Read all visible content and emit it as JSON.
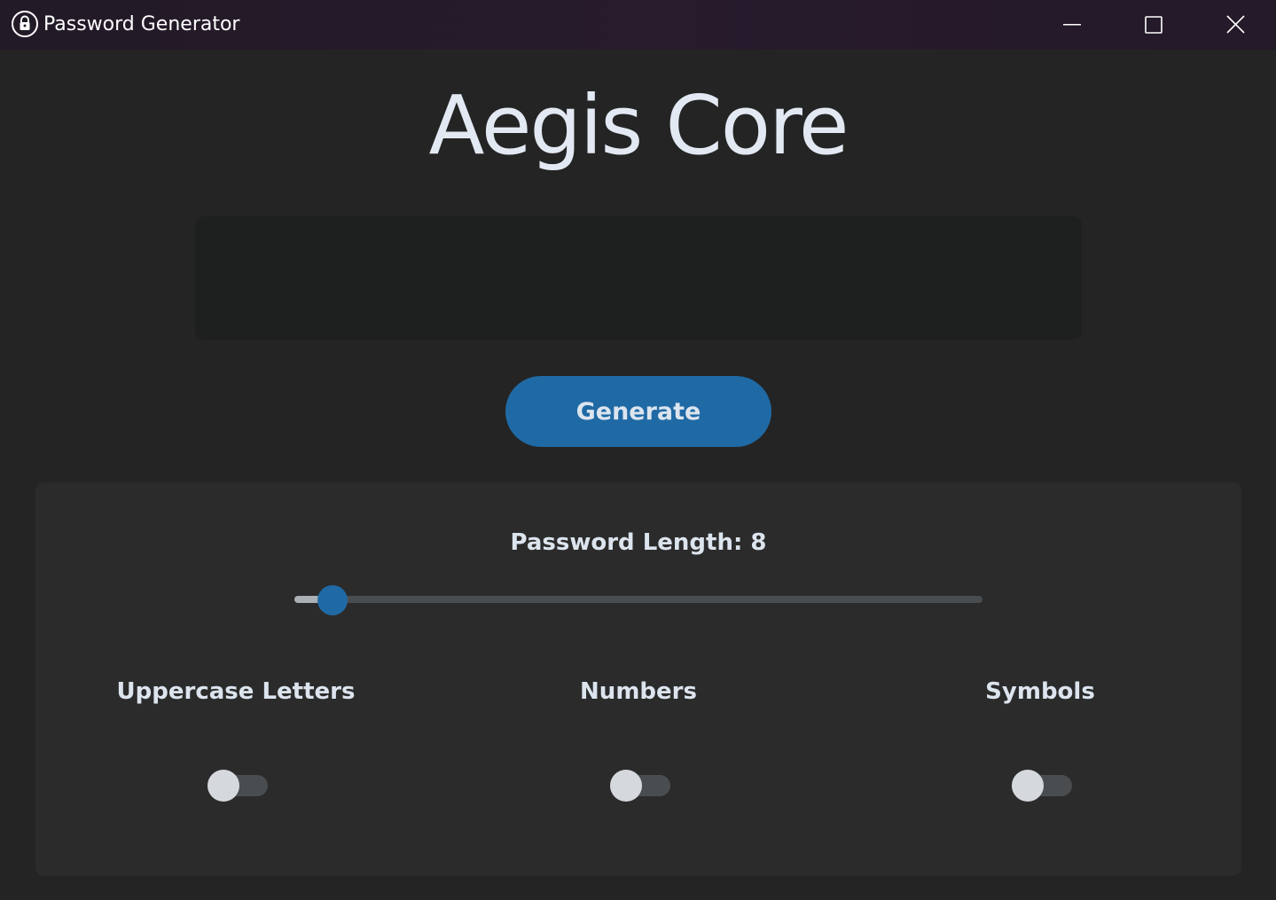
{
  "window": {
    "title": "Password Generator",
    "icon": "lock-icon"
  },
  "controls": {
    "minimize": "minimize-icon",
    "maximize": "maximize-icon",
    "close": "close-icon"
  },
  "app": {
    "heading": "Aegis Core",
    "password_value": "",
    "generate_label": "Generate"
  },
  "options": {
    "length_label": "Password Length: 8",
    "length_value": 8,
    "length_fraction": 0.055,
    "toggles": [
      {
        "label": "Uppercase Letters",
        "on": false
      },
      {
        "label": "Numbers",
        "on": false
      },
      {
        "label": "Symbols",
        "on": false
      }
    ]
  },
  "colors": {
    "accent": "#1f6aa5",
    "background": "#242424",
    "panel": "#2b2b2b",
    "text": "#dce4ee"
  }
}
